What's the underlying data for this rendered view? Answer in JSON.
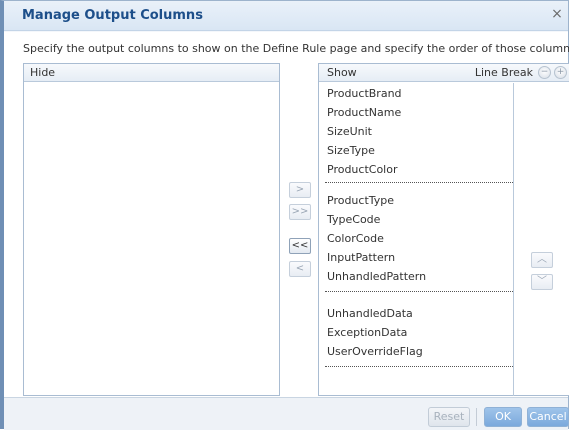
{
  "dialog": {
    "title": "Manage Output Columns",
    "close_glyph": "×",
    "instruction": "Specify the output columns to show on the Define Rule page and specify the order of those columns."
  },
  "hide_panel": {
    "title": "Hide",
    "items": []
  },
  "show_panel": {
    "title": "Show",
    "line_break_label": "Line Break",
    "line_break_remove_icon": "minus-circle-icon",
    "line_break_add_icon": "plus-circle-icon",
    "items": [
      {
        "label": "ProductBrand"
      },
      {
        "label": "ProductName"
      },
      {
        "label": "SizeUnit"
      },
      {
        "label": "SizeType"
      },
      {
        "label": "ProductColor"
      },
      {
        "label": "ProductType"
      },
      {
        "label": "TypeCode"
      },
      {
        "label": "ColorCode"
      },
      {
        "label": "InputPattern"
      },
      {
        "label": "UnhandledPattern"
      },
      {
        "label": "UnhandledData"
      },
      {
        "label": "ExceptionData"
      },
      {
        "label": "UserOverrideFlag"
      }
    ]
  },
  "transfer_buttons": {
    "move_right": ">",
    "move_all_right": ">>",
    "move_all_left": "<<",
    "move_left": "<"
  },
  "order_buttons": {
    "up_icon": "chevron-up-icon",
    "down_icon": "chevron-down-icon"
  },
  "footer": {
    "reset_label": "Reset",
    "ok_label": "OK",
    "cancel_label": "Cancel"
  },
  "colors": {
    "title_text": "#1d4f8a",
    "primary_button": "#7ba9dc",
    "panel_border": "#a9bcd2"
  }
}
